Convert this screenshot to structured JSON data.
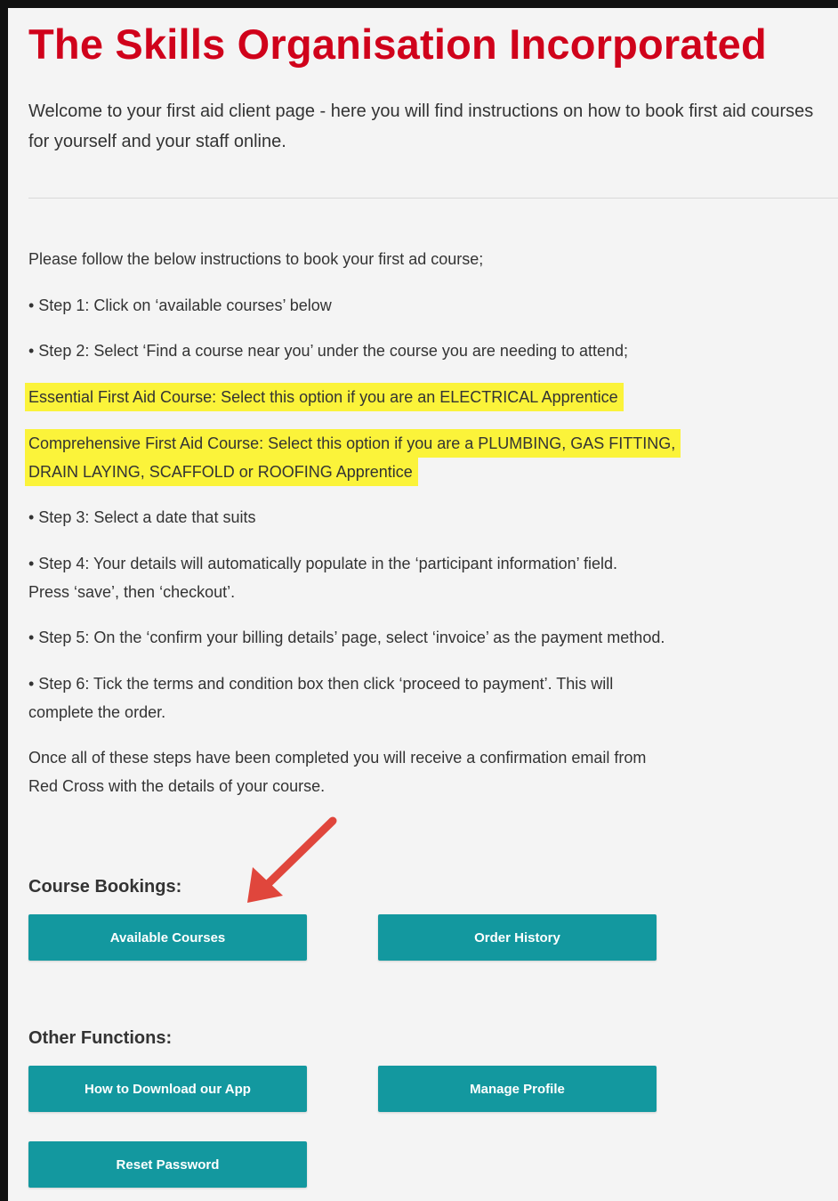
{
  "header": {
    "title": "The Skills Organisation Incorporated",
    "welcome": "Welcome to your first aid client page - here you will find instructions on how to book first aid courses for yourself and your staff online."
  },
  "instructions": {
    "intro": "Please follow the below instructions to book your first ad course;",
    "step1": "• Step 1: Click on ‘available courses’ below",
    "step2": "• Step 2: Select ‘Find a course near you’ under the course you are needing to attend;",
    "highlight1": "Essential First Aid Course: Select this option if you are an ELECTRICAL Apprentice",
    "highlight2_line1": "Comprehensive First Aid Course: Select this option if you are a PLUMBING, GAS FITTING,",
    "highlight2_line2": "DRAIN LAYING, SCAFFOLD or ROOFING Apprentice",
    "step3": "• Step 3: Select a date that suits",
    "step4_line1": "• Step 4: Your details will automatically populate in the ‘participant information’ field.",
    "step4_line2": "Press ‘save’, then ‘checkout’.",
    "step5": "• Step 5: On the ‘confirm your billing details’ page, select ‘invoice’ as the payment method.",
    "step6_line1": "• Step 6: Tick the terms and condition box then click ‘proceed to payment’. This will",
    "step6_line2": "complete the order.",
    "closing_line1": "Once all of these steps have been completed you will receive a confirmation email from",
    "closing_line2": "Red Cross with the details of your course."
  },
  "course_bookings": {
    "label": "Course Bookings:",
    "available_courses": "Available Courses",
    "order_history": "Order History"
  },
  "other_functions": {
    "label": "Other Functions:",
    "download_app": "How to Download our App",
    "manage_profile": "Manage Profile",
    "reset_password": "Reset Password"
  },
  "colors": {
    "title": "#d0021b",
    "button": "#13989f",
    "highlight": "#fbf33a",
    "arrow": "#e0463c"
  }
}
